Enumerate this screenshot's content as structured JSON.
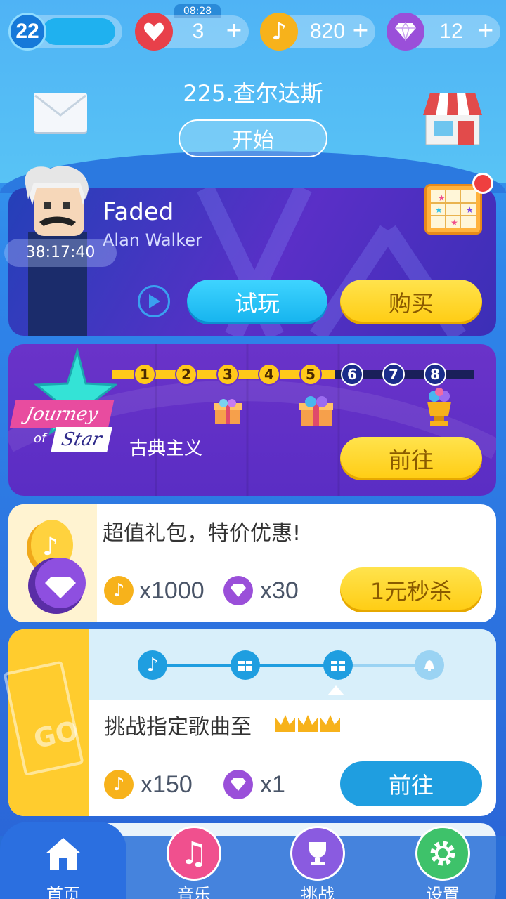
{
  "status": {
    "level": "22",
    "clock": "08:28",
    "lives": "3",
    "notes": "820",
    "gems": "12",
    "plus": "+"
  },
  "header": {
    "song_title": "225.查尔达斯",
    "start_label": "开始"
  },
  "promo_song": {
    "title": "Faded",
    "artist": "Alan Walker",
    "timer": "38:17:40",
    "try_label": "试玩",
    "buy_label": "购买"
  },
  "journey": {
    "logo_line1": "Journey",
    "logo_line2": "of",
    "logo_line3": "Star",
    "steps": [
      "1",
      "2",
      "3",
      "4",
      "5",
      "6",
      "7",
      "8"
    ],
    "completed_steps": 5,
    "genre": "古典主义",
    "go_label": "前往"
  },
  "gift_pack": {
    "title": "超值礼包，特价优惠!",
    "notes_reward": "x1000",
    "gems_reward": "x30",
    "buy_label": "1元秒杀"
  },
  "challenge": {
    "badge": "GO",
    "title": "挑战指定歌曲至",
    "notes_reward": "x150",
    "gems_reward": "x1",
    "go_label": "前往"
  },
  "tabs": [
    {
      "label": "首页",
      "icon": "home-icon"
    },
    {
      "label": "音乐",
      "icon": "music-icon"
    },
    {
      "label": "挑战",
      "icon": "trophy-icon"
    },
    {
      "label": "设置",
      "icon": "gear-icon"
    }
  ],
  "colors": {
    "accent_yellow": "#ffcc12",
    "accent_cyan": "#15b3ee",
    "heart_red": "#e8404a",
    "coin_gold": "#f7b21b",
    "gem_purple": "#9a4fd9"
  }
}
